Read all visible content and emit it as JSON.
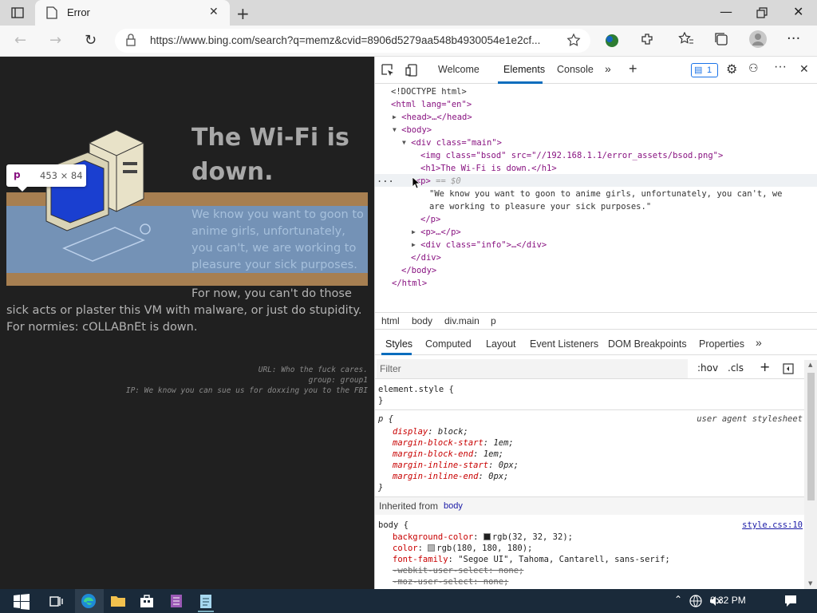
{
  "browser": {
    "tab_title": "Error",
    "url": "https://www.bing.com/search?q=memz&cvid=8906d5279aa548b4930054e1e2cf..."
  },
  "page": {
    "heading": "The Wi-Fi is down.",
    "paragraph1": "We know you want to goon to anime girls, unfortunately, you can't, we are working to pleasure your sick purposes.",
    "paragraph2_line1": "For now, you can't do those",
    "paragraph2_rest": "sick acts or plaster this VM with malware, or just do stupidity. For normies: cOLLABnEt is down.",
    "info": [
      "URL: Who the fuck cares.",
      "group: group1",
      "IP: We know you can sue us for doxxing you to the FBI"
    ],
    "tooltip": {
      "tag": "p",
      "dims": "453 × 84"
    }
  },
  "devtools": {
    "tabs": [
      "Welcome",
      "Elements",
      "Console"
    ],
    "active_tab": "Elements",
    "issues_count": "1",
    "dom": {
      "doctype": "<!DOCTYPE html>",
      "html_open": "<html lang=\"en\">",
      "head": "<head>…</head>",
      "body_open": "<body>",
      "div_main": "<div class=\"main\">",
      "img": "<img class=\"bsod\" src=\"//192.168.1.1/error_assets/bsod.png\">",
      "h1": "<h1>The Wi-Fi is down.</h1>",
      "p_open": "<p>",
      "p_marker": "== $0",
      "p_text_1": "\"We know you want to goon to anime girls, unfortunately, you can't, we",
      "p_text_2": "are working to pleasure your sick purposes.\"",
      "p_close": "</p>",
      "p_collapsed": "<p>…</p>",
      "div_info": "<div class=\"info\">…</div>",
      "div_close": "</div>",
      "body_close": "</body>",
      "html_close": "</html>"
    },
    "breadcrumb": [
      "html",
      "body",
      "div.main",
      "p"
    ],
    "subtabs": [
      "Styles",
      "Computed",
      "Layout",
      "Event Listeners",
      "DOM Breakpoints",
      "Properties"
    ],
    "filter_placeholder": "Filter",
    "hov": ":hov",
    "cls": ".cls",
    "styles": {
      "element_style": "element.style {",
      "close_brace": "}",
      "p_selector": "p {",
      "ua_label": "user agent stylesheet",
      "p_props": [
        [
          "display",
          "block;"
        ],
        [
          "margin-block-start",
          "1em;"
        ],
        [
          "margin-block-end",
          "1em;"
        ],
        [
          "margin-inline-start",
          "0px;"
        ],
        [
          "margin-inline-end",
          "0px;"
        ]
      ],
      "inherited_label": "Inherited from",
      "inherited_el": "body",
      "body_selector": "body {",
      "source": "style.css:10",
      "body_bg_prop": "background-color",
      "body_bg_val": "rgb(32, 32, 32);",
      "body_color_prop": "color",
      "body_color_val": "rgb(180, 180, 180);",
      "font_prop": "font-family",
      "font_val": "\"Segoe UI\", Tahoma, Cantarell, sans-serif;",
      "struck1": "-webkit-user-select: none;",
      "struck2": "-moz-user-select: none;"
    }
  },
  "taskbar": {
    "time": "8:32 PM"
  },
  "colors": {
    "page_bg": "#202020",
    "accent": "#0b6dbd"
  }
}
